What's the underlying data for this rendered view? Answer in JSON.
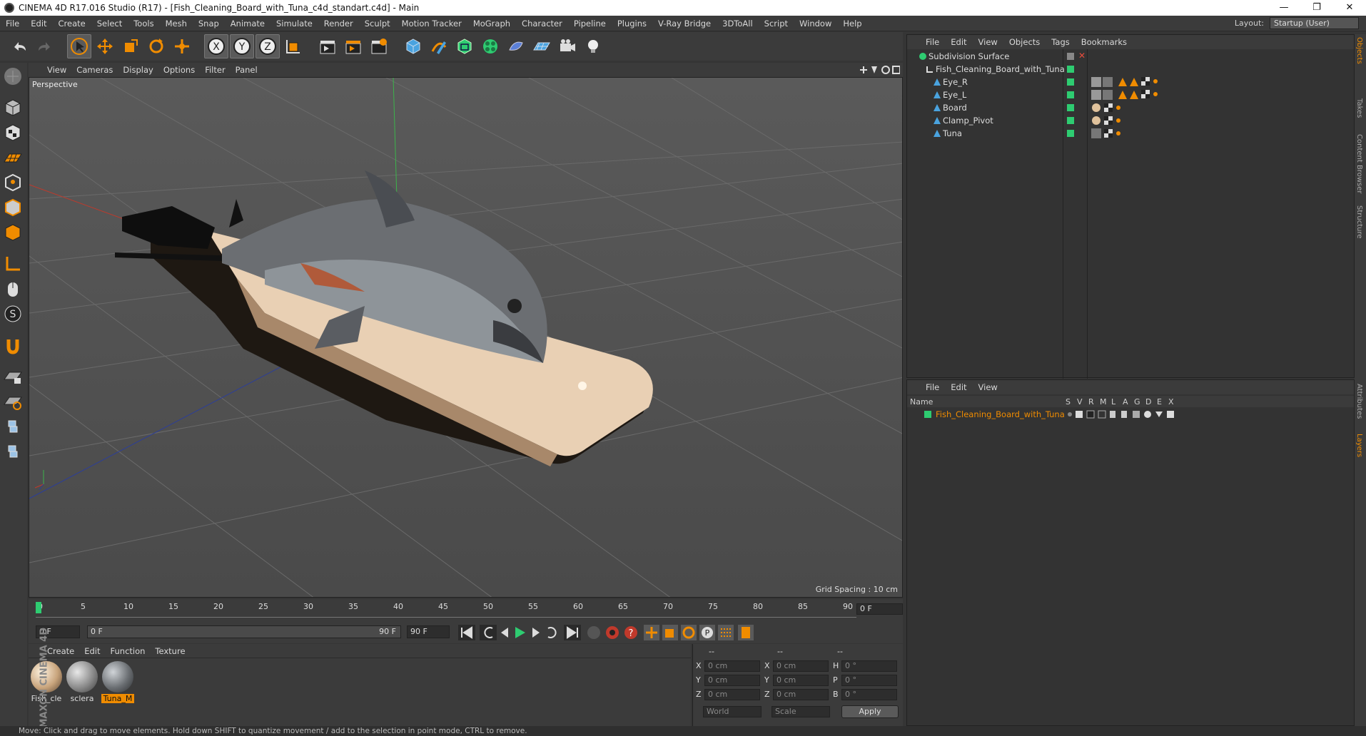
{
  "window": {
    "title": "CINEMA 4D R17.016 Studio (R17) - [Fish_Cleaning_Board_with_Tuna_c4d_standart.c4d] - Main",
    "controls": [
      "—",
      "❐",
      "✕"
    ]
  },
  "menubar": {
    "items": [
      "File",
      "Edit",
      "Create",
      "Select",
      "Tools",
      "Mesh",
      "Snap",
      "Animate",
      "Simulate",
      "Render",
      "Sculpt",
      "Motion Tracker",
      "MoGraph",
      "Character",
      "Pipeline",
      "Plugins",
      "V-Ray Bridge",
      "3DToAll",
      "Script",
      "Window",
      "Help"
    ],
    "layout_label": "Layout:",
    "layout_value": "Startup (User)"
  },
  "viewport": {
    "menu": [
      "View",
      "Cameras",
      "Display",
      "Options",
      "Filter",
      "Panel"
    ],
    "label": "Perspective",
    "grid_spacing": "Grid Spacing : 10 cm"
  },
  "timeline": {
    "ticks": [
      "0",
      "5",
      "10",
      "15",
      "20",
      "25",
      "30",
      "35",
      "40",
      "45",
      "50",
      "55",
      "60",
      "65",
      "70",
      "75",
      "80",
      "85",
      "90"
    ],
    "current_frame": "0 F",
    "start_field": "0 F",
    "range_start": "0 F",
    "range_end": "90 F",
    "end_field": "90 F"
  },
  "material_manager": {
    "menu": [
      "Create",
      "Edit",
      "Function",
      "Texture"
    ],
    "materials": [
      {
        "name": "Fish_cle",
        "selected": false
      },
      {
        "name": "sclera",
        "selected": false
      },
      {
        "name": "Tuna_M",
        "selected": true
      }
    ]
  },
  "coordinates": {
    "header": [
      "--",
      "--",
      "--"
    ],
    "rows": [
      {
        "a": "X",
        "av": "0 cm",
        "b": "X",
        "bv": "0 cm",
        "c": "H",
        "cv": "0 °"
      },
      {
        "a": "Y",
        "av": "0 cm",
        "b": "Y",
        "bv": "0 cm",
        "c": "P",
        "cv": "0 °"
      },
      {
        "a": "Z",
        "av": "0 cm",
        "b": "Z",
        "bv": "0 cm",
        "c": "B",
        "cv": "0 °"
      }
    ],
    "world": "World",
    "scale": "Scale",
    "apply": "Apply"
  },
  "object_manager": {
    "menu": [
      "File",
      "Edit",
      "View",
      "Objects",
      "Tags",
      "Bookmarks"
    ],
    "objects": [
      {
        "name": "Subdivision Surface",
        "indent": 0
      },
      {
        "name": "Fish_Cleaning_Board_with_Tuna",
        "indent": 1
      },
      {
        "name": "Eye_R",
        "indent": 2
      },
      {
        "name": "Eye_L",
        "indent": 2
      },
      {
        "name": "Board",
        "indent": 2
      },
      {
        "name": "Clamp_Pivot",
        "indent": 2
      },
      {
        "name": "Tuna",
        "indent": 2
      }
    ]
  },
  "layer_manager": {
    "menu": [
      "File",
      "Edit",
      "View"
    ],
    "columns": [
      "Name",
      "S",
      "V",
      "R",
      "M",
      "L",
      "A",
      "G",
      "D",
      "E",
      "X"
    ],
    "layer_name": "Fish_Cleaning_Board_with_Tuna"
  },
  "side_tabs": [
    "Objects",
    "Takes",
    "Content Browser",
    "Structure",
    "Attributes",
    "Layers"
  ],
  "status": "Move: Click and drag to move elements. Hold down SHIFT to quantize movement / add to the selection in point mode, CTRL to remove.",
  "brand": "MAXON CINEMA 4D",
  "colors": {
    "accent": "#f08c00",
    "green": "#2ecc71",
    "bg": "#353535"
  }
}
